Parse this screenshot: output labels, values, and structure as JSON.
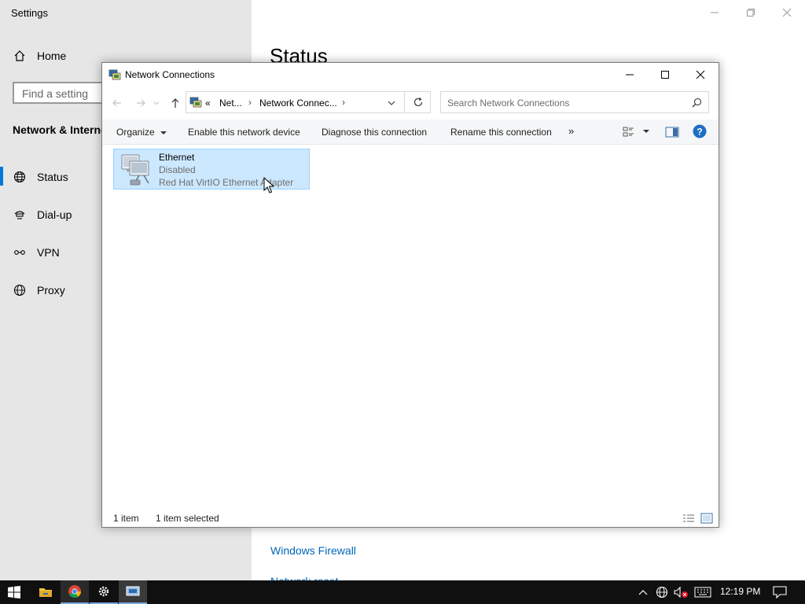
{
  "settings": {
    "app_title": "Settings",
    "home_label": "Home",
    "find_placeholder": "Find a setting",
    "section_title": "Network & Interne",
    "nav": [
      {
        "label": "Status",
        "icon": "globe-status-icon",
        "active": true
      },
      {
        "label": "Dial-up",
        "icon": "dialup-icon"
      },
      {
        "label": "VPN",
        "icon": "vpn-icon"
      },
      {
        "label": "Proxy",
        "icon": "globe-icon"
      }
    ],
    "page_title": "Status",
    "links": [
      "Windows Firewall",
      "Network reset"
    ]
  },
  "network_connections": {
    "title": "Network Connections",
    "address": {
      "overflow": "«",
      "crumbs": [
        "Net...",
        "Network Connec..."
      ]
    },
    "search_placeholder": "Search Network Connections",
    "commands": [
      "Organize",
      "Enable this network device",
      "Diagnose this connection",
      "Rename this connection",
      "»"
    ],
    "items": [
      {
        "name": "Ethernet",
        "state": "Disabled",
        "adapter": "Red Hat VirtIO Ethernet Adapter",
        "selected": true
      }
    ],
    "status": {
      "count": "1 item",
      "selection": "1 item selected"
    }
  },
  "taskbar": {
    "apps": [
      "start-icon",
      "file-explorer-icon",
      "chrome-icon",
      "settings-gear-icon",
      "network-connections-icon"
    ],
    "clock": "12:19 PM"
  },
  "colors": {
    "accent": "#0078d7",
    "selection_bg": "#cce8ff",
    "selection_border": "#99d1ff",
    "link": "#0067b8",
    "taskbar": "#101010"
  }
}
